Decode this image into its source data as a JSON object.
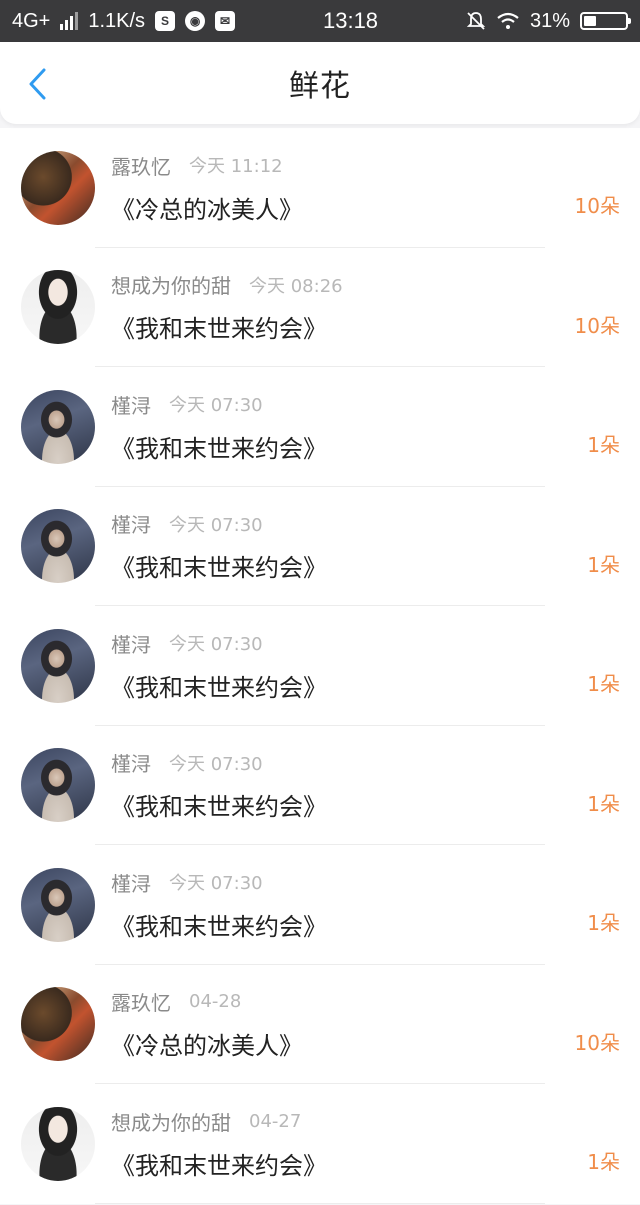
{
  "status_bar": {
    "network": "4G+",
    "speed": "1.1K/s",
    "time": "13:18",
    "battery": "31%",
    "battery_level": 0.31
  },
  "header": {
    "title": "鲜花"
  },
  "rows": [
    {
      "name": "露玖忆",
      "time": "今天 11:12",
      "book": "《冷总的冰美人》",
      "count": "10朵",
      "avatar": "avatar-luojiuyi"
    },
    {
      "name": "想成为你的甜",
      "time": "今天 08:26",
      "book": "《我和末世来约会》",
      "count": "10朵",
      "avatar": "avatar-tian"
    },
    {
      "name": "槿浔",
      "time": "今天 07:30",
      "book": "《我和末世来约会》",
      "count": "1朵",
      "avatar": "avatar-jinxun"
    },
    {
      "name": "槿浔",
      "time": "今天 07:30",
      "book": "《我和末世来约会》",
      "count": "1朵",
      "avatar": "avatar-jinxun"
    },
    {
      "name": "槿浔",
      "time": "今天 07:30",
      "book": "《我和末世来约会》",
      "count": "1朵",
      "avatar": "avatar-jinxun"
    },
    {
      "name": "槿浔",
      "time": "今天 07:30",
      "book": "《我和末世来约会》",
      "count": "1朵",
      "avatar": "avatar-jinxun"
    },
    {
      "name": "槿浔",
      "time": "今天 07:30",
      "book": "《我和末世来约会》",
      "count": "1朵",
      "avatar": "avatar-jinxun"
    },
    {
      "name": "露玖忆",
      "time": "04-28",
      "book": "《冷总的冰美人》",
      "count": "10朵",
      "avatar": "avatar-luojiuyi"
    },
    {
      "name": "想成为你的甜",
      "time": "04-27",
      "book": "《我和末世来约会》",
      "count": "1朵",
      "avatar": "avatar-tian"
    }
  ],
  "colors": {
    "accent": "#2f9bf0",
    "count": "#f08d4a",
    "statusbar": "#3a3a3c"
  }
}
